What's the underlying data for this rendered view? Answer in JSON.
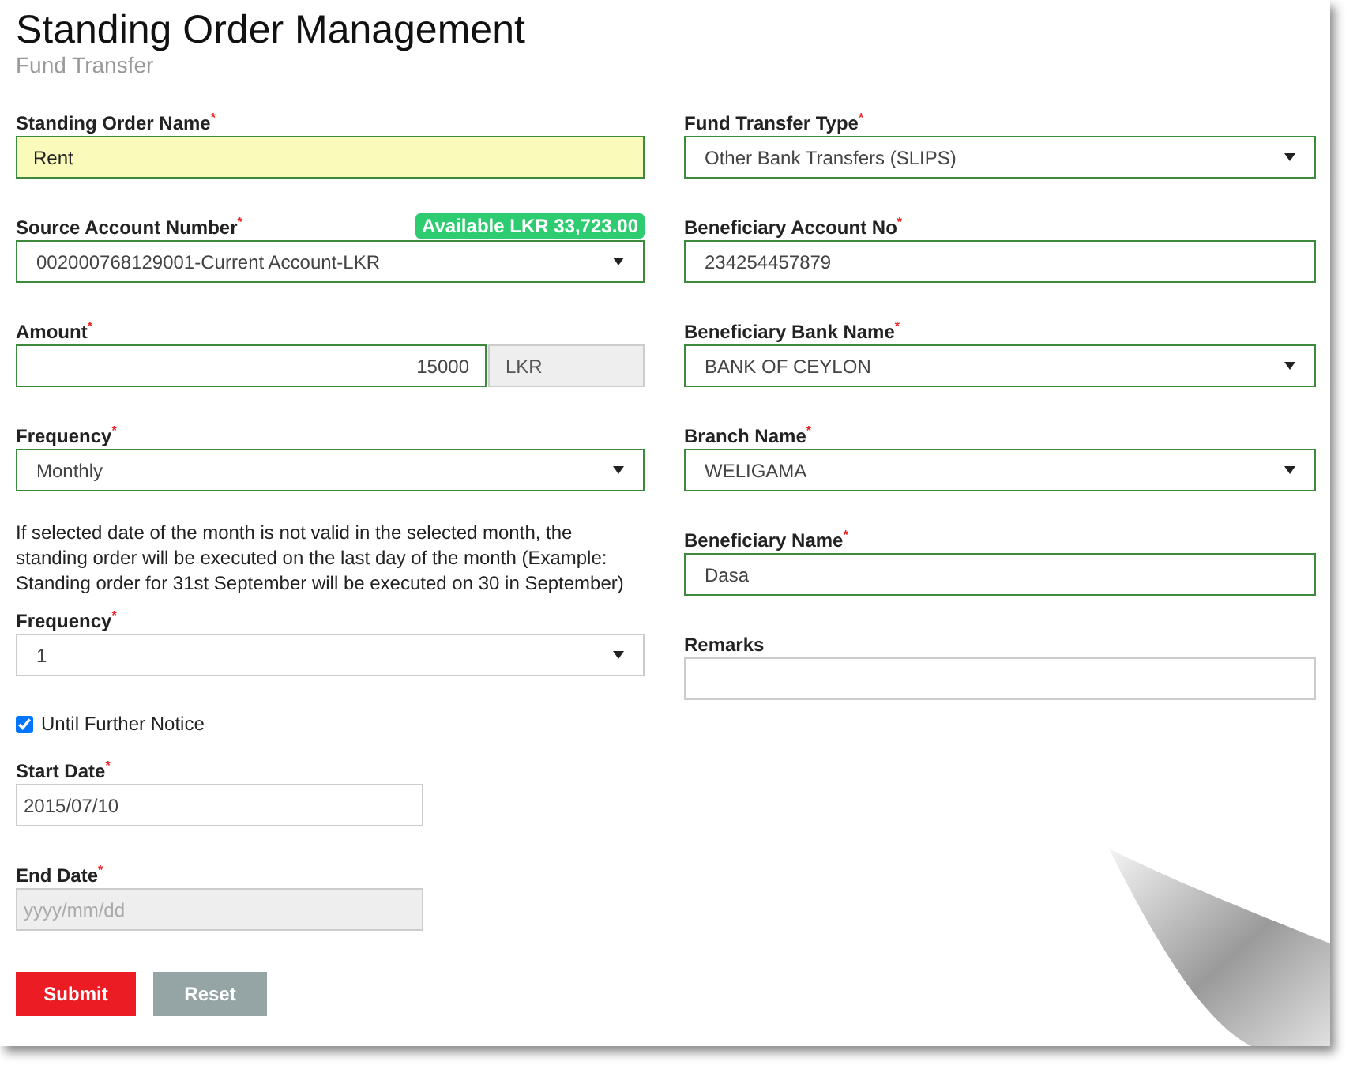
{
  "title": "Standing Order Management",
  "subtitle": "Fund Transfer",
  "left": [
    {
      "kind": "text",
      "label": "Standing Order Name$^{*}$",
      "value": "Rent",
      "valid": true,
      "focused": true
    },
    {
      "kind": "select",
      "label": "Source Account Number$^{*}$",
      "badge": "Available LKR 33,723.00",
      "value": "002000768129001-Current Account-LKR",
      "valid": true
    },
    {
      "kind": "amount",
      "label": "Amount$^{*}$",
      "value": "15000",
      "unit": "LKR",
      "valid": true
    },
    {
      "kind": "select",
      "label": "Frequency$^{*}$",
      "value": "Monthly",
      "valid": true
    },
    {
      "kind": "note",
      "text": "If selected date of the month is not valid in the selected month, the standing order will be executed on the last day of the month (Example: Standing order for 31st September will be executed on 30 in September)"
    },
    {
      "kind": "select",
      "label": "Frequency$^{*}$",
      "value": "1",
      "valid": false
    },
    {
      "kind": "checkbox",
      "label": "Until Further Notice",
      "checked": true
    },
    {
      "kind": "date",
      "label": "Start Date$^{*}$",
      "value": "2015/07/10",
      "disabled": false
    },
    {
      "kind": "date",
      "label": "End Date$^{*}$",
      "placeholder": "yyyy/mm/dd",
      "disabled": true
    }
  ],
  "right": [
    {
      "kind": "select",
      "label": "Fund Transfer Type$^{*}$",
      "value": "Other Bank Transfers (SLIPS)",
      "valid": true
    },
    {
      "kind": "text",
      "label": "Beneficiary Account No$^{*}$",
      "value": "234254457879",
      "valid": true,
      "focused": false
    },
    {
      "kind": "select",
      "label": "Beneficiary Bank Name$^{*}$",
      "value": "BANK OF CEYLON",
      "valid": true
    },
    {
      "kind": "select",
      "label": "Branch Name$^{*}$",
      "value": "WELIGAMA",
      "valid": true
    },
    {
      "kind": "text",
      "label": "Beneficiary Name$^{*}$",
      "value": "Dasa",
      "valid": true,
      "focused": false
    },
    {
      "kind": "text",
      "label": "Remarks",
      "valid": false,
      "focused": false
    }
  ],
  "buttons": [
    {
      "label": "Submit",
      "kind": "primary"
    },
    {
      "label": "Reset",
      "kind": "secondary"
    }
  ]
}
